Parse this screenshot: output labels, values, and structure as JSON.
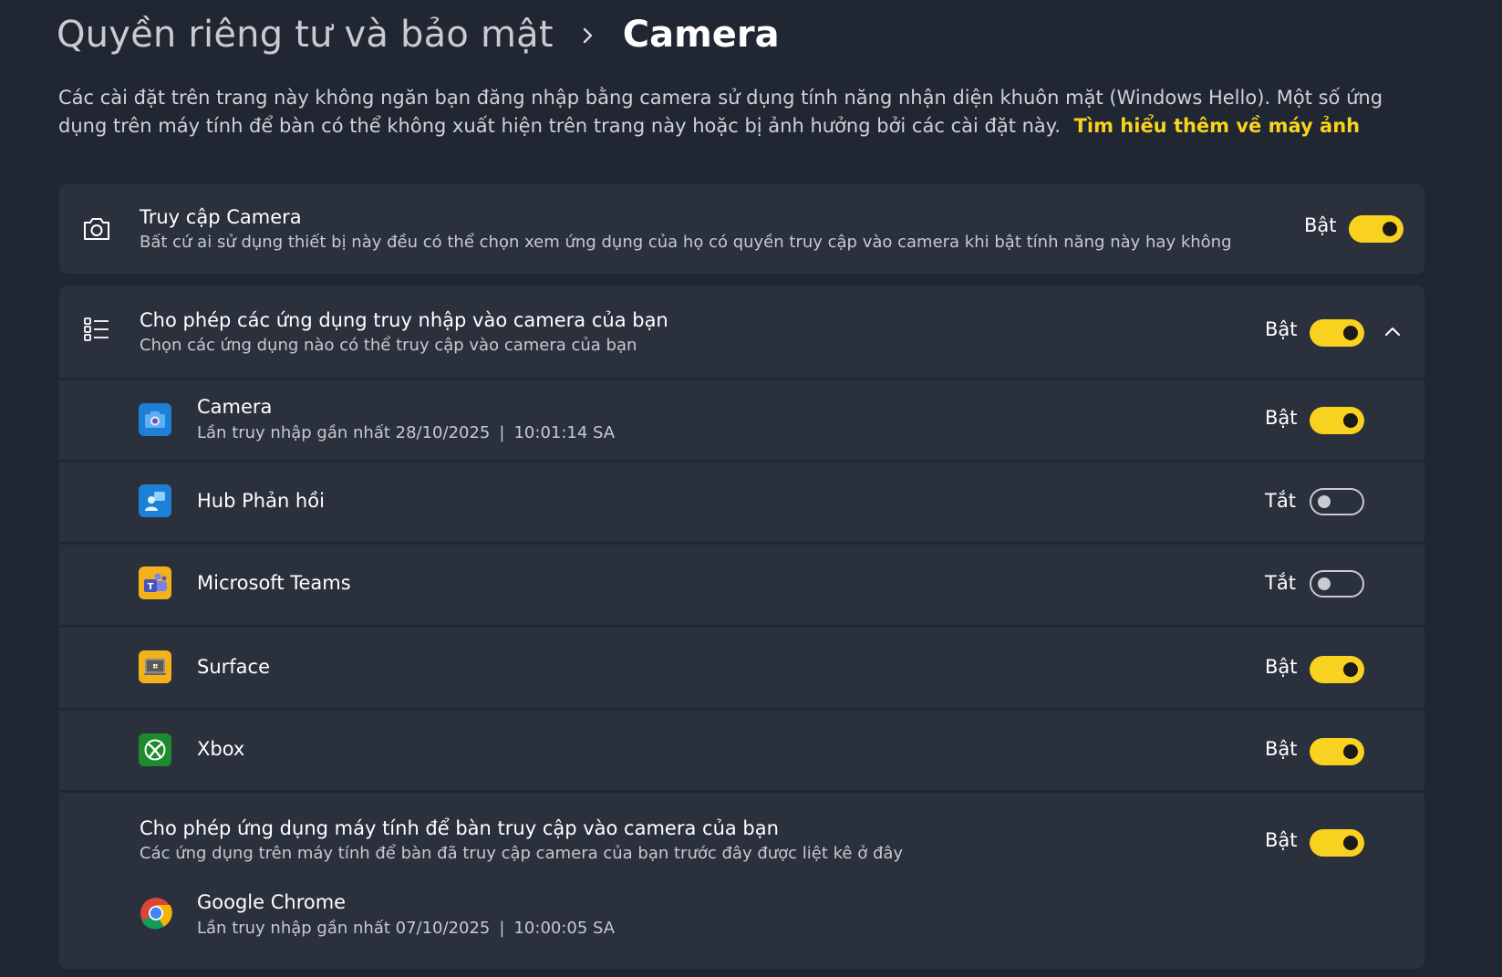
{
  "breadcrumb": {
    "parent": "Quyền riêng tư và bảo mật",
    "current": "Camera"
  },
  "description": {
    "text": "Các cài đặt trên trang này không ngăn bạn đăng nhập bằng camera sử dụng tính năng nhận diện khuôn mặt (Windows Hello). Một số ứng dụng trên máy tính để bàn có thể không xuất hiện trên trang này hoặc bị ảnh hưởng bởi các cài đặt này.",
    "link": "Tìm hiểu thêm về máy ảnh"
  },
  "camera_access": {
    "icon": "camera-icon",
    "title": "Truy cập Camera",
    "subtitle": "Bất cứ ai sử dụng thiết bị này đều có thể chọn xem ứng dụng của họ có quyền truy cập vào camera khi bật tính năng này hay không",
    "state_label": "Bật",
    "on": true
  },
  "app_access": {
    "icon": "list-icon",
    "title": "Cho phép các ứng dụng truy nhập vào camera của bạn",
    "subtitle": "Chọn các ứng dụng nào có thể truy cập vào camera của bạn",
    "state_label": "Bật",
    "on": true,
    "expand_icon": "chevron-up-icon"
  },
  "apps": [
    {
      "name": "Camera",
      "last_access_label": "Lần truy nhập gần nhất 28/10/2025",
      "separator": "|",
      "last_access_time": "10:01:14 SA",
      "state_label": "Bật",
      "on": true,
      "icon": "camera-app-icon",
      "icon_color": "#1e7fd6"
    },
    {
      "name": "Hub Phản hồi",
      "state_label": "Tắt",
      "on": false,
      "icon": "feedback-hub-icon",
      "icon_color": "#1e7fd6"
    },
    {
      "name": "Microsoft Teams",
      "state_label": "Tắt",
      "on": false,
      "icon": "teams-icon",
      "icon_color": "#f2b21b"
    },
    {
      "name": "Surface",
      "state_label": "Bật",
      "on": true,
      "icon": "surface-icon",
      "icon_color": "#f2b21b"
    },
    {
      "name": "Xbox",
      "state_label": "Bật",
      "on": true,
      "icon": "xbox-icon",
      "icon_color": "#1e8a2e"
    }
  ],
  "desktop_apps": {
    "title": "Cho phép ứng dụng máy tính để bàn truy cập vào camera của bạn",
    "subtitle": "Các ứng dụng trên máy tính để bàn đã truy cập camera của bạn trước đây được liệt kê ở đây",
    "state_label": "Bật",
    "on": true,
    "items": [
      {
        "name": "Google Chrome",
        "last_access_label": "Lần truy nhập gần nhất 07/10/2025",
        "separator": "|",
        "last_access_time": "10:00:05 SA",
        "icon": "chrome-icon"
      }
    ]
  },
  "colors": {
    "background": "#202632",
    "card": "#2a303c",
    "accent": "#f9d21f",
    "link": "#f7d31d"
  }
}
